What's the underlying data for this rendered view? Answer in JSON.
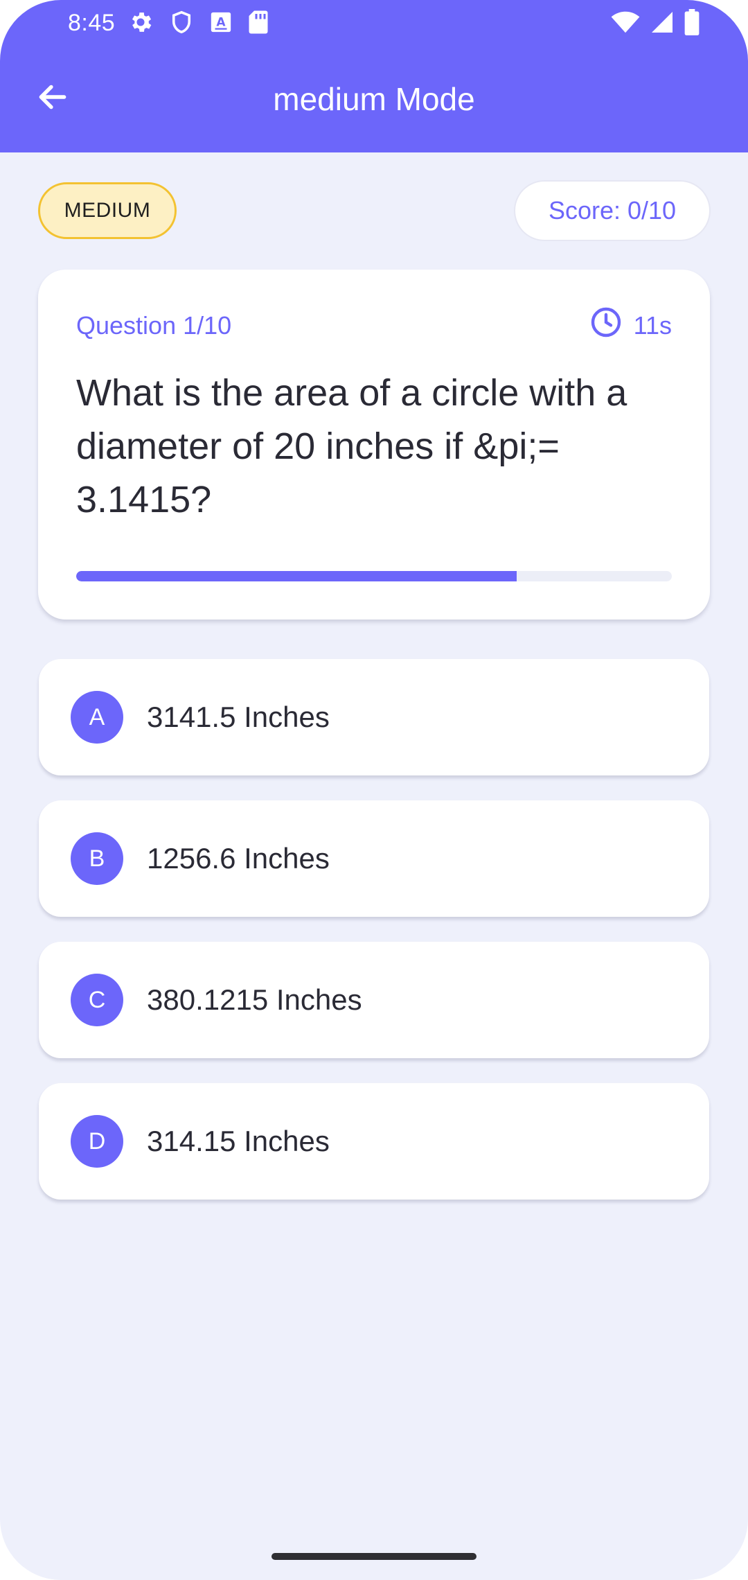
{
  "status_bar": {
    "time": "8:45",
    "left_icons": [
      "gear-icon",
      "shield-icon",
      "a-keyboard-icon",
      "sd-card-icon"
    ],
    "right_icons": [
      "wifi-icon",
      "signal-icon",
      "battery-icon"
    ]
  },
  "header": {
    "title": "medium Mode",
    "back_icon": "arrow-left-icon",
    "color": "#6c66fa"
  },
  "difficulty_badge": {
    "label": "MEDIUM",
    "bg": "#fdf0c4",
    "border": "#f3c231"
  },
  "score": {
    "label": "Score: 0/10"
  },
  "question": {
    "label": "Question 1/10",
    "timer_icon": "clock-icon",
    "timer": "11s",
    "text": "What is the area of a circle with a diameter of 20 inches if &pi;= 3.1415?",
    "time_progress": 0.74
  },
  "options": [
    {
      "letter": "A",
      "text": "3141.5 Inches"
    },
    {
      "letter": "B",
      "text": "1256.6 Inches"
    },
    {
      "letter": "C",
      "text": "380.1215 Inches"
    },
    {
      "letter": "D",
      "text": "314.15 Inches"
    }
  ],
  "colors": {
    "accent": "#6c66fa",
    "background": "#eef0fb",
    "text": "#2a2a35"
  }
}
